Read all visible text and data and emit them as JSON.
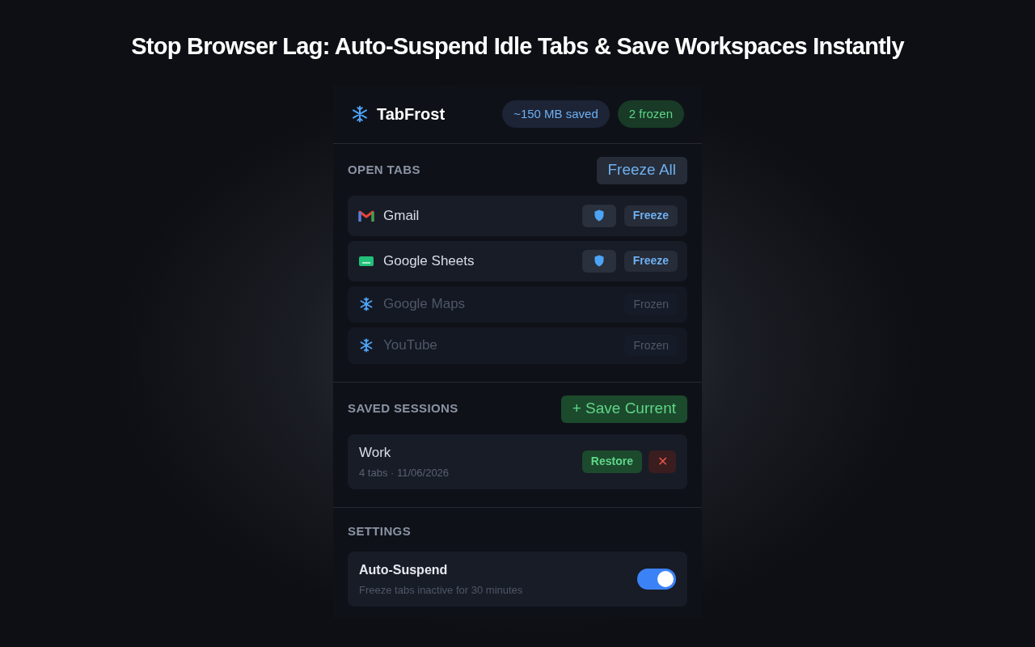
{
  "headline": "Stop Browser Lag: Auto-Suspend Idle Tabs & Save Workspaces Instantly",
  "header": {
    "title": "TabFrost",
    "saved_badge": "~150 MB saved",
    "frozen_badge": "2 frozen"
  },
  "open_tabs": {
    "heading": "OPEN TABS",
    "action": "Freeze All",
    "tabs": [
      {
        "kind": "mail",
        "name": "Gmail",
        "frozen": false,
        "button": "Freeze"
      },
      {
        "kind": "sheet",
        "name": "Google Sheets",
        "frozen": false,
        "button": "Freeze"
      },
      {
        "name": "Google Maps",
        "frozen": true,
        "button": "Frozen"
      },
      {
        "name": "YouTube",
        "frozen": true,
        "button": "Frozen"
      }
    ]
  },
  "saved_sessions": {
    "heading": "SAVED SESSIONS",
    "action": "+ Save Current",
    "sessions": [
      {
        "name": "Work",
        "meta": "4 tabs · 11/06/2026",
        "restore": "Restore",
        "delete": "✕"
      }
    ]
  },
  "settings": {
    "heading": "SETTINGS",
    "items": [
      {
        "label": "Auto-Suspend",
        "description": "Freeze tabs inactive for 30 minutes",
        "on": true
      }
    ]
  }
}
